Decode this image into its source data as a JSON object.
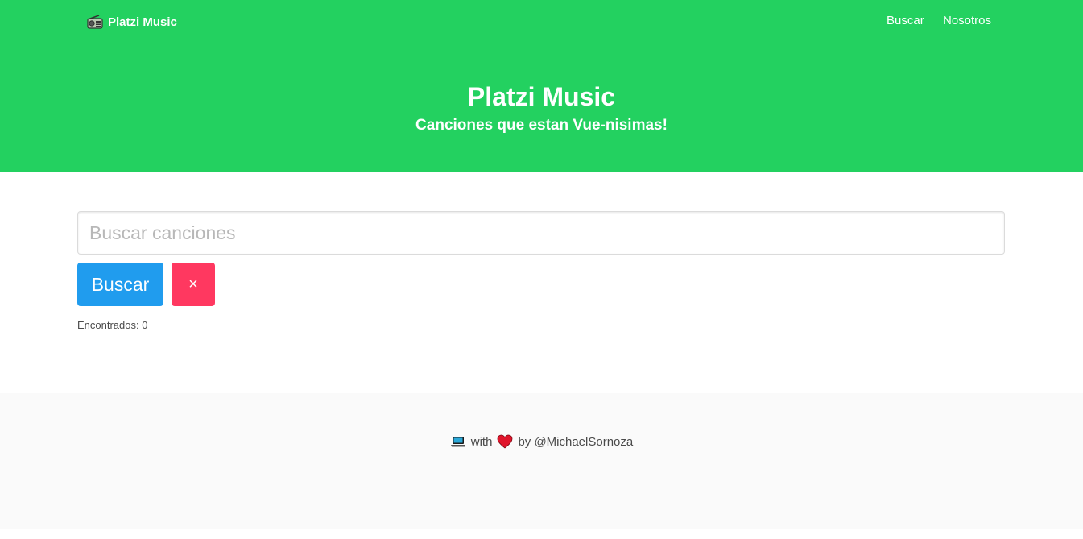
{
  "navbar": {
    "brand_label": "Platzi Music",
    "brand_icon": "radio-icon",
    "links": [
      {
        "label": "Buscar"
      },
      {
        "label": "Nosotros"
      }
    ]
  },
  "hero": {
    "title": "Platzi Music",
    "subtitle": "Canciones que estan Vue-nisimas!"
  },
  "search": {
    "placeholder": "Buscar canciones",
    "value": "",
    "search_button_label": "Buscar",
    "clear_button_label": "×",
    "found_text": "Encontrados: 0"
  },
  "footer": {
    "icon_laptop": "laptop-icon",
    "with_text": "with",
    "icon_heart": "heart-icon",
    "by_text": "by @MichaelSornoza"
  },
  "colors": {
    "hero_bg": "#23d160",
    "search_button": "#209cee",
    "clear_button": "#ff3860",
    "footer_bg": "#fafafa"
  }
}
